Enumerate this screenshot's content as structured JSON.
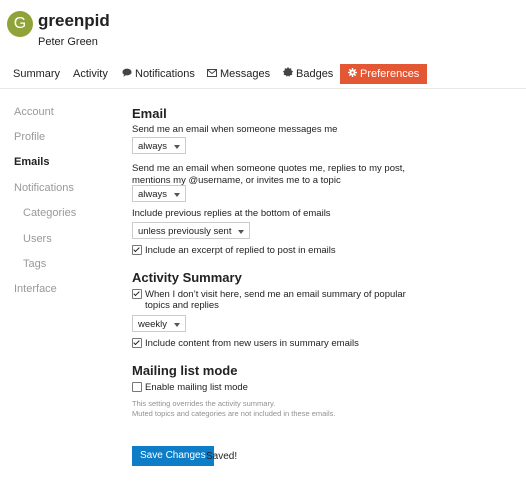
{
  "header": {
    "avatar_letter": "G",
    "avatar_color": "#8fa33a",
    "username": "greenpid",
    "full_name": "Peter Green"
  },
  "nav": {
    "tabs": [
      {
        "label": "Summary"
      },
      {
        "label": "Activity"
      },
      {
        "label": "Notifications",
        "icon": "comment-icon"
      },
      {
        "label": "Messages",
        "icon": "envelope-icon"
      },
      {
        "label": "Badges",
        "icon": "badge-icon"
      },
      {
        "label": "Preferences",
        "icon": "gear-icon",
        "active": true
      }
    ],
    "active_color": "#e45735"
  },
  "sidebar": {
    "items": [
      {
        "label": "Account"
      },
      {
        "label": "Profile"
      },
      {
        "label": "Emails",
        "active": true
      },
      {
        "label": "Notifications"
      },
      {
        "label": "Categories"
      },
      {
        "label": "Users"
      },
      {
        "label": "Tags"
      },
      {
        "label": "Interface"
      }
    ]
  },
  "email": {
    "heading": "Email",
    "messages_label": "Send me an email when someone messages me",
    "messages_value": "always",
    "quotes_label": "Send me an email when someone quotes me, replies to my post, mentions my @username, or invites me to a topic",
    "quotes_value": "always",
    "previous_label": "Include previous replies at the bottom of emails",
    "previous_value": "unless previously sent",
    "excerpt_label": "Include an excerpt of replied to post in emails",
    "excerpt_checked": true
  },
  "activity": {
    "heading": "Activity Summary",
    "digest_label": "When I don’t visit here, send me an email summary of popular topics and replies",
    "digest_checked": true,
    "frequency_value": "weekly",
    "new_users_label": "Include content from new users in summary emails",
    "new_users_checked": true
  },
  "mailing": {
    "heading": "Mailing list mode",
    "enable_label": "Enable mailing list mode",
    "enable_checked": false,
    "note_line1": "This setting overrides the activity summary.",
    "note_line2": "Muted topics and categories are not included in these emails."
  },
  "actions": {
    "save_label": "Save Changes",
    "saved_text": "Saved!",
    "save_color": "#0e7dc8"
  }
}
